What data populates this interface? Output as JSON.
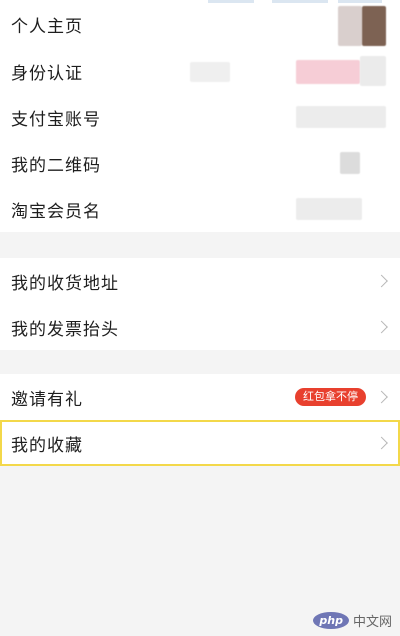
{
  "profile_group": [
    {
      "id": "homepage",
      "label": "个人主页"
    },
    {
      "id": "id-verify",
      "label": "身份认证"
    },
    {
      "id": "alipay",
      "label": "支付宝账号"
    },
    {
      "id": "qrcode",
      "label": "我的二维码"
    },
    {
      "id": "taobao-name",
      "label": "淘宝会员名"
    }
  ],
  "address_group": [
    {
      "id": "address",
      "label": "我的收货地址"
    },
    {
      "id": "invoice",
      "label": "我的发票抬头"
    }
  ],
  "extra_group": {
    "invite": {
      "label": "邀请有礼",
      "badge": "红包拿不停"
    },
    "favorites": {
      "label": "我的收藏"
    }
  },
  "watermark": {
    "logo": "php",
    "text": "中文网"
  },
  "colors": {
    "badge_bg": "#e8402e",
    "highlight_border": "#f3d84a",
    "page_bg": "#f4f4f4"
  }
}
